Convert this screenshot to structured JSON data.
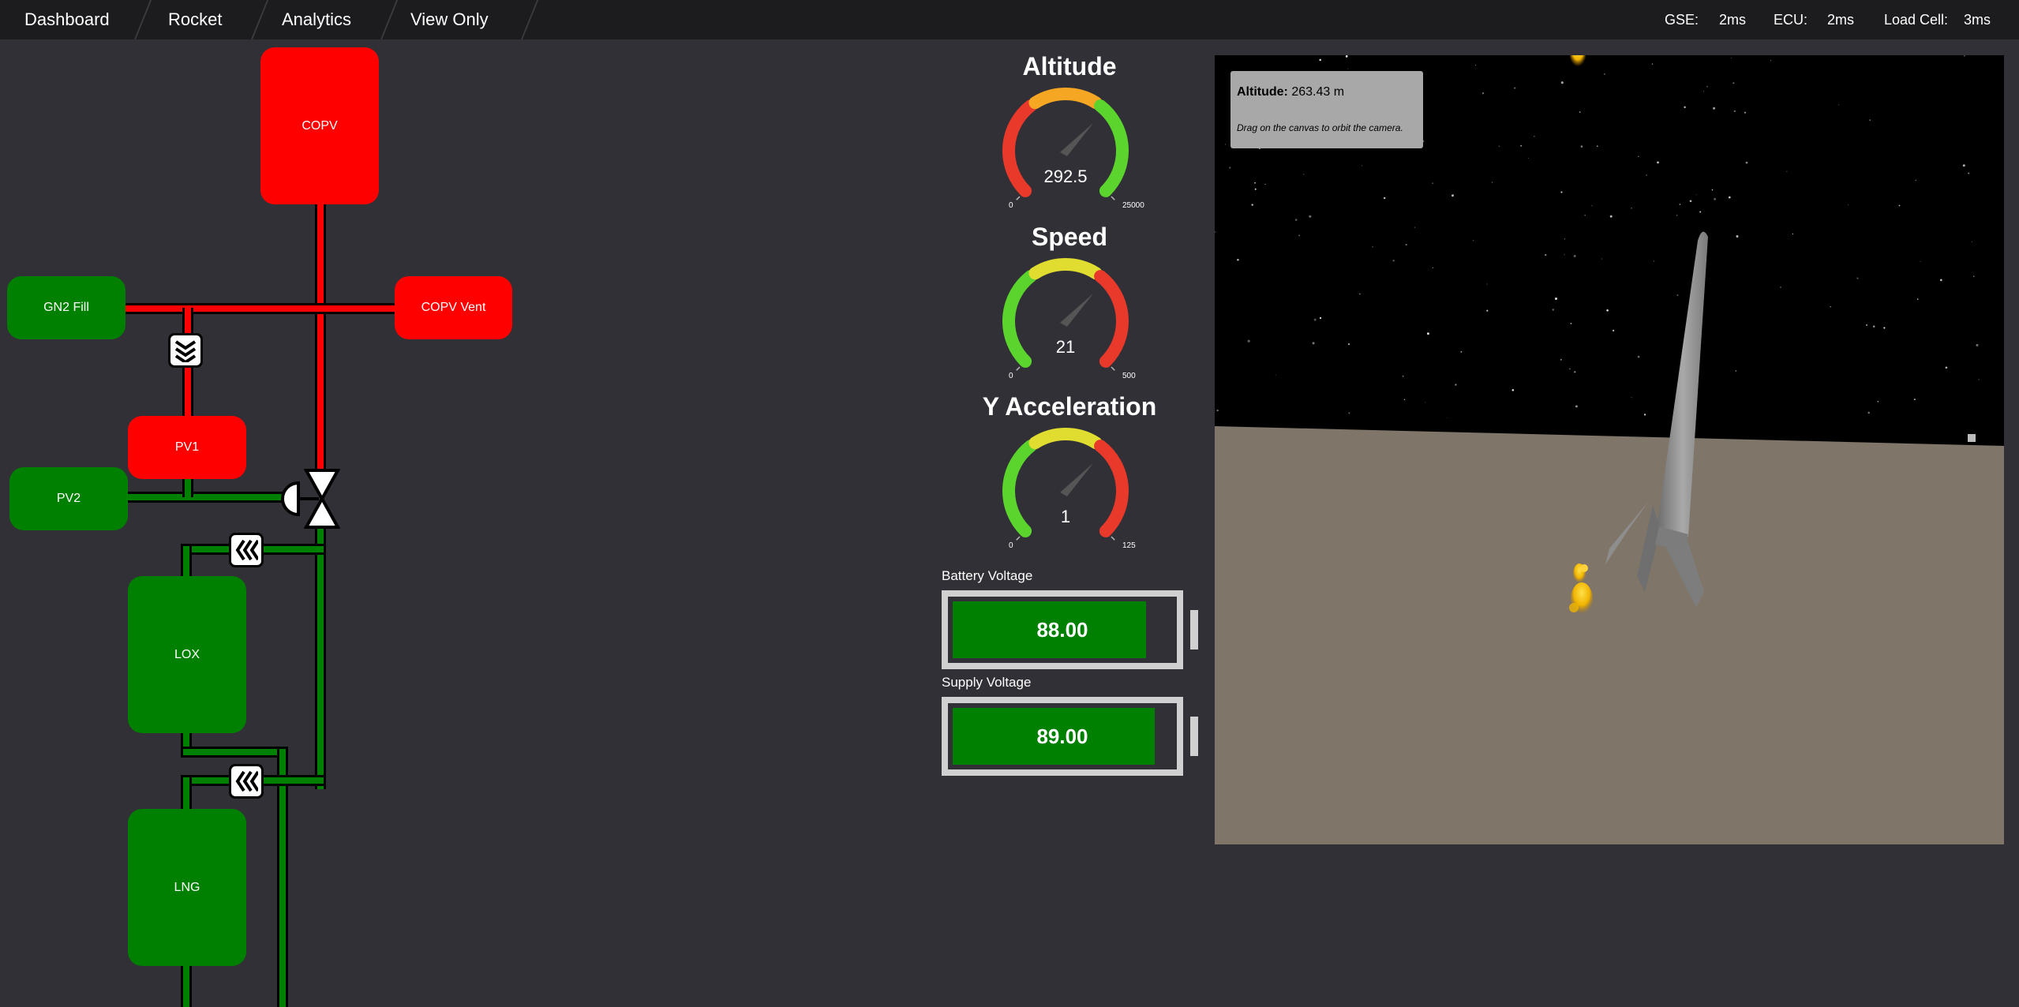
{
  "nav": {
    "tabs": [
      "Dashboard",
      "Rocket",
      "Analytics",
      "View Only"
    ]
  },
  "status": {
    "gse_label": "GSE:",
    "gse_value": "2ms",
    "ecu_label": "ECU:",
    "ecu_value": "2ms",
    "load_cell_label": "Load Cell:",
    "load_cell_value": "3ms"
  },
  "pid": {
    "copv": "COPV",
    "gn2_fill": "GN2 Fill",
    "copv_vent": "COPV Vent",
    "pv1": "PV1",
    "pv2": "PV2",
    "lox": "LOX",
    "lng": "LNG",
    "colors": {
      "active": "#ff0000",
      "inactive": "#008000"
    }
  },
  "gauges": [
    {
      "title": "Altitude",
      "value": "292.5",
      "min": "0",
      "max": "25000",
      "fraction": 0.0117,
      "zones": [
        "#e8392b",
        "#f5a623",
        "#5bd42e"
      ]
    },
    {
      "title": "Speed",
      "value": "21",
      "min": "0",
      "max": "500",
      "fraction": 0.042,
      "zones": [
        "#5bd42e",
        "#e0dc30",
        "#e8392b"
      ]
    },
    {
      "title": "Y Acceleration",
      "value": "1",
      "min": "0",
      "max": "125",
      "fraction": 0.008,
      "zones": [
        "#5bd42e",
        "#e0dc30",
        "#e8392b"
      ]
    }
  ],
  "batteries": [
    {
      "label": "Battery Voltage",
      "value": "88.00",
      "fraction": 0.88
    },
    {
      "label": "Supply Voltage",
      "value": "89.00",
      "fraction": 0.92
    }
  ],
  "viewer": {
    "altitude_label": "Altitude:",
    "altitude_value": "263.43 m",
    "hint": "Drag on the canvas to orbit the camera.",
    "sky_color": "#000000",
    "ground_color": "#7f7568"
  }
}
